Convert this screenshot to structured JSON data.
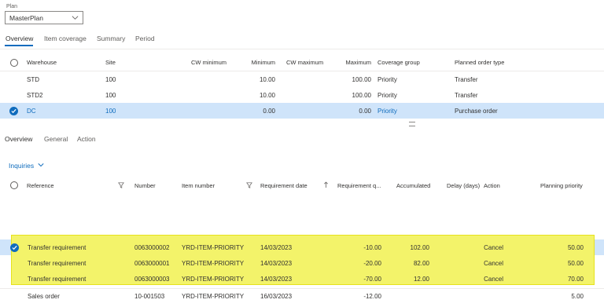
{
  "plan": {
    "label": "Plan",
    "value": "MasterPlan"
  },
  "top_tabs": [
    "Overview",
    "Item coverage",
    "Summary",
    "Period"
  ],
  "coverage_grid": {
    "headers": {
      "warehouse": "Warehouse",
      "site": "Site",
      "cw_minimum": "CW minimum",
      "minimum": "Minimum",
      "cw_maximum": "CW maximum",
      "maximum": "Maximum",
      "coverage_group": "Coverage group",
      "planned_order_type": "Planned order type"
    },
    "rows": [
      {
        "warehouse": "STD",
        "site": "100",
        "minimum": "10.00",
        "maximum": "100.00",
        "coverage_group": "Priority",
        "planned_order_type": "Transfer"
      },
      {
        "warehouse": "STD2",
        "site": "100",
        "minimum": "10.00",
        "maximum": "100.00",
        "coverage_group": "Priority",
        "planned_order_type": "Transfer"
      },
      {
        "warehouse": "DC",
        "site": "100",
        "minimum": "0.00",
        "maximum": "0.00",
        "coverage_group": "Priority",
        "planned_order_type": "Purchase order"
      }
    ]
  },
  "lower_tabs": [
    "Overview",
    "General",
    "Action"
  ],
  "inquiries_label": "Inquiries",
  "net_grid": {
    "headers": {
      "reference": "Reference",
      "number": "Number",
      "item_number": "Item number",
      "requirement_date": "Requirement date",
      "requirement_qty": "Requirement q...",
      "accumulated": "Accumulated",
      "delay_days": "Delay (days)",
      "action": "Action",
      "planning_priority": "Planning priority"
    },
    "rows": [
      {
        "reference": "Transfer requirement",
        "number": "0063000002",
        "item_number": "YRD-ITEM-PRIORITY",
        "requirement_date": "14/03/2023",
        "requirement_qty": "-10.00",
        "accumulated": "102.00",
        "action": "Cancel",
        "planning_priority": "50.00"
      },
      {
        "reference": "Transfer requirement",
        "number": "0063000001",
        "item_number": "YRD-ITEM-PRIORITY",
        "requirement_date": "14/03/2023",
        "requirement_qty": "-20.00",
        "accumulated": "82.00",
        "action": "Cancel",
        "planning_priority": "50.00"
      },
      {
        "reference": "Transfer requirement",
        "number": "0063000003",
        "item_number": "YRD-ITEM-PRIORITY",
        "requirement_date": "14/03/2023",
        "requirement_qty": "-70.00",
        "accumulated": "12.00",
        "action": "Cancel",
        "planning_priority": "70.00"
      },
      {
        "reference": "Sales order",
        "number": "10-001503",
        "item_number": "YRD-ITEM-PRIORITY",
        "requirement_date": "16/03/2023",
        "requirement_qty": "-12.00",
        "accumulated": "",
        "action": "",
        "planning_priority": "5.00"
      }
    ]
  },
  "colors": {
    "accent": "#0f6cbd",
    "selected_row": "#cfe4fa",
    "highlight": "#f3f36a"
  }
}
